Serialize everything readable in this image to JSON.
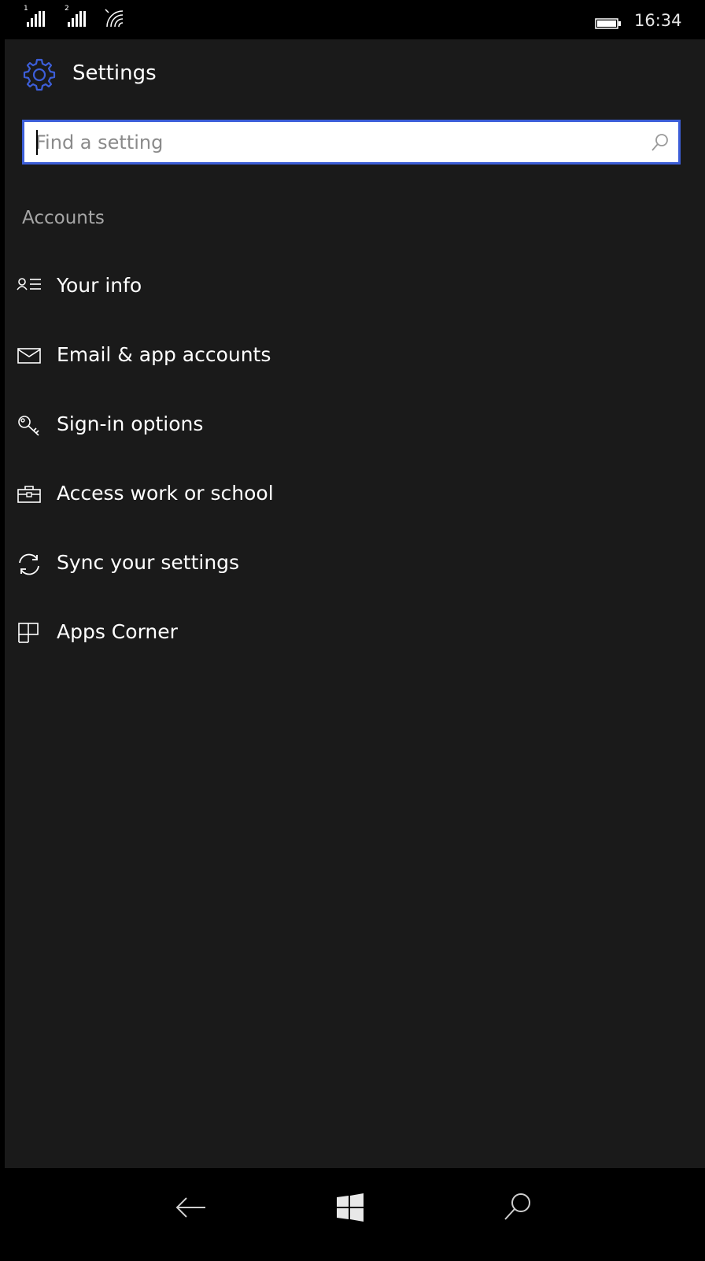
{
  "status_bar": {
    "sim1_label": "1",
    "sim2_label": "2",
    "time": "16:34",
    "icons": [
      "signal-sim1-icon",
      "signal-sim2-icon",
      "wifi-icon",
      "battery-icon"
    ]
  },
  "header": {
    "title": "Settings",
    "icon": "gear-icon",
    "accent_color": "#3c5ed8"
  },
  "search": {
    "placeholder": "Find a setting",
    "value": "",
    "icon": "search-icon"
  },
  "section": {
    "heading": "Accounts"
  },
  "items": [
    {
      "label": "Your info",
      "icon": "person-list-icon"
    },
    {
      "label": "Email & app accounts",
      "icon": "mail-icon"
    },
    {
      "label": "Sign-in options",
      "icon": "key-icon"
    },
    {
      "label": "Access work or school",
      "icon": "briefcase-icon"
    },
    {
      "label": "Sync your settings",
      "icon": "sync-icon"
    },
    {
      "label": "Apps Corner",
      "icon": "apps-corner-icon"
    }
  ],
  "nav": {
    "back": "back-arrow-icon",
    "start": "windows-logo-icon",
    "search": "search-icon"
  },
  "colors": {
    "background": "#1a1a1a",
    "text": "#ffffff",
    "secondary_text": "#a6a6a6",
    "accent": "#3c5ed8"
  }
}
